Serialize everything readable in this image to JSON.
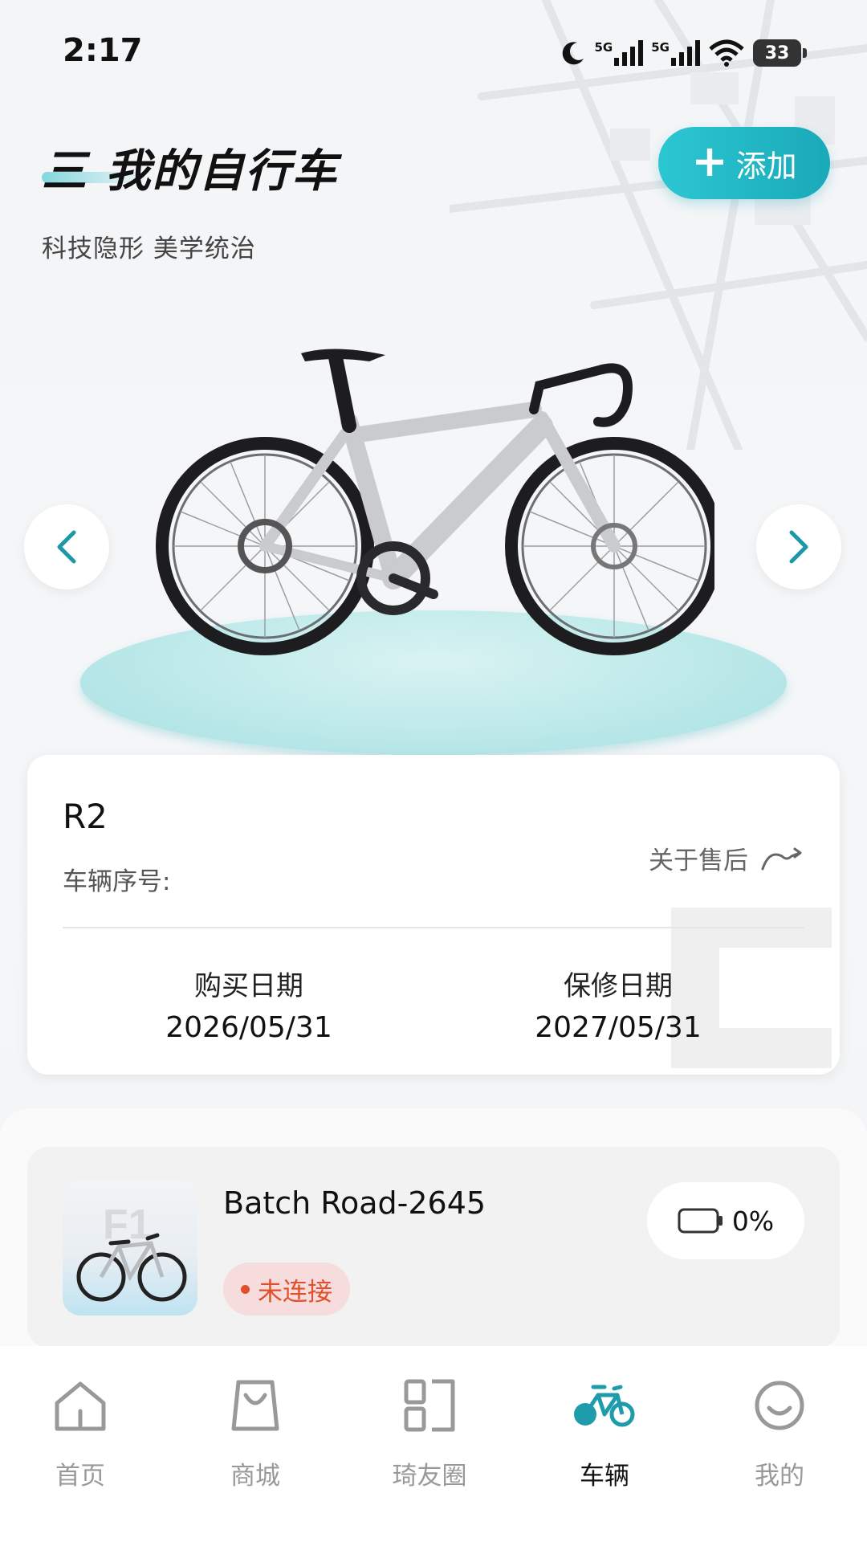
{
  "status_bar": {
    "time": "2:17",
    "signal_1": "5G",
    "signal_2": "5G",
    "battery": "33"
  },
  "header": {
    "title": "三 我的自行车",
    "subtitle": "科技隐形 美学统治",
    "add_button_label": "添加"
  },
  "bike_card": {
    "model": "R2",
    "serial_label": "车辆序号:",
    "after_sales_label": "关于售后",
    "purchase_date_label": "购买日期",
    "purchase_date": "2026/05/31",
    "warranty_date_label": "保修日期",
    "warranty_date": "2027/05/31"
  },
  "device": {
    "name": "Batch Road-2645",
    "status": "未连接",
    "battery": "0%"
  },
  "tabs": [
    {
      "label": "首页",
      "icon": "home-icon",
      "active": false
    },
    {
      "label": "商城",
      "icon": "shopping-bag-icon",
      "active": false
    },
    {
      "label": "琦友圈",
      "icon": "community-grid-icon",
      "active": false
    },
    {
      "label": "车辆",
      "icon": "bicycle-icon",
      "active": true
    },
    {
      "label": "我的",
      "icon": "smiley-icon",
      "active": false
    }
  ],
  "colors": {
    "accent": "#1fb5c3",
    "status_disconnected": "#e0502a",
    "tab_inactive": "#999999",
    "tab_active": "#111111"
  }
}
